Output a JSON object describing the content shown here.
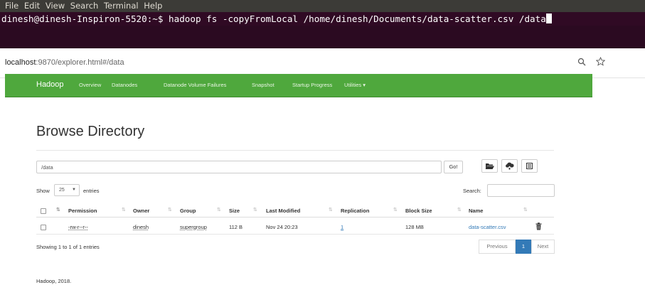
{
  "terminal": {
    "menu": [
      "File",
      "Edit",
      "View",
      "Search",
      "Terminal",
      "Help"
    ],
    "prompt": "dinesh@dinesh-Inspiron-5520:~$ hadoop fs -copyFromLocal /home/dinesh/Documents/data-scatter.csv /data"
  },
  "browser": {
    "url_host": "localhost",
    "url_rest": ":9870/explorer.html#/data",
    "zoom_icon": "zoom-icon",
    "bookmark_icon": "star-icon"
  },
  "navbar": {
    "brand": "Hadoop",
    "items": [
      "Overview",
      "Datanodes",
      "Datanode Volume Failures",
      "Snapshot",
      "Startup Progress",
      "Utilities ▾"
    ]
  },
  "page": {
    "title": "Browse Directory",
    "path_value": "/data",
    "go_label": "Go!",
    "show_label": "Show",
    "entries_count": "25",
    "entries_label": "entries",
    "search_label": "Search:",
    "showing_text": "Showing 1 to 1 of 1 entries",
    "footer": "Hadoop, 2018."
  },
  "table": {
    "headers": [
      "Permission",
      "Owner",
      "Group",
      "Size",
      "Last Modified",
      "Replication",
      "Block Size",
      "Name"
    ],
    "rows": [
      {
        "permission": "-rw-r--r--",
        "owner": "dinesh",
        "group": "supergroup",
        "size": "112 B",
        "last_modified": "Nov 24 20:23",
        "replication": "1",
        "block_size": "128 MB",
        "name": "data-scatter.csv"
      }
    ]
  },
  "pagination": {
    "previous": "Previous",
    "current": "1",
    "next": "Next"
  },
  "colors": {
    "navbar": "#4fa83d",
    "link": "#337ab7",
    "terminal_bg": "#300a24",
    "active_page": "#337ab7"
  }
}
